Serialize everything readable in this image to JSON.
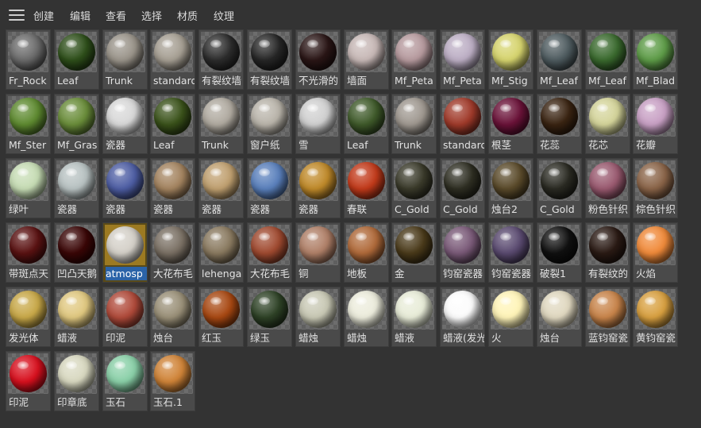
{
  "menu": [
    "创建",
    "编辑",
    "查看",
    "选择",
    "材质",
    "纹理"
  ],
  "materials": [
    {
      "label": "Fr_Rock",
      "color": "#6b6b6b"
    },
    {
      "label": "Leaf",
      "color": "#2e4f1a"
    },
    {
      "label": "Trunk",
      "color": "#9a948a"
    },
    {
      "label": "standard",
      "color": "#a69f93"
    },
    {
      "label": "有裂纹墙",
      "color": "#2c2c2c"
    },
    {
      "label": "有裂纹墙",
      "color": "#262626"
    },
    {
      "label": "不光滑的",
      "color": "#2a1616"
    },
    {
      "label": "墙面",
      "color": "#c7b8b6"
    },
    {
      "label": "Mf_Peta",
      "color": "#b69a9e"
    },
    {
      "label": "Mf_Peta",
      "color": "#bcaec4"
    },
    {
      "label": "Mf_Stig",
      "color": "#d6d46e"
    },
    {
      "label": "Mf_Leaf",
      "color": "#4f5c60"
    },
    {
      "label": "Mf_Leaf",
      "color": "#3a6a2e"
    },
    {
      "label": "Mf_Blad",
      "color": "#5e9c48"
    },
    {
      "label": "Mf_Ster",
      "color": "#5e8a30"
    },
    {
      "label": "Mf_Gras",
      "color": "#6a8d3a"
    },
    {
      "label": "瓷器",
      "color": "#d8d8d8"
    },
    {
      "label": "Leaf",
      "color": "#3a521a"
    },
    {
      "label": "Trunk",
      "color": "#b0aaa0"
    },
    {
      "label": "窗户纸",
      "color": "#b9b4aa"
    },
    {
      "label": "雪",
      "color": "#d0d0d0"
    },
    {
      "label": "Leaf",
      "color": "#3f5a2a"
    },
    {
      "label": "Trunk",
      "color": "#9f9890"
    },
    {
      "label": "standard",
      "color": "#a03a2a"
    },
    {
      "label": "根茎",
      "color": "#6a1238"
    },
    {
      "label": "花蕊",
      "color": "#3a2412"
    },
    {
      "label": "花芯",
      "color": "#d4d49a"
    },
    {
      "label": "花瓣",
      "color": "#c8a0c4"
    },
    {
      "label": "绿叶",
      "color": "#c6dcb4"
    },
    {
      "label": "瓷器",
      "color": "#b8c2c2"
    },
    {
      "label": "瓷器",
      "color": "#4e5ea4"
    },
    {
      "label": "瓷器",
      "color": "#a48460"
    },
    {
      "label": "瓷器",
      "color": "#c0a070"
    },
    {
      "label": "瓷器",
      "color": "#5a80bc"
    },
    {
      "label": "瓷器",
      "color": "#c08a2a"
    },
    {
      "label": "春联",
      "color": "#c23a1a"
    },
    {
      "label": "C_Gold",
      "color": "#3a3a2a"
    },
    {
      "label": "C_Gold",
      "color": "#2e2e22"
    },
    {
      "label": "烛台2",
      "color": "#5a4a2a"
    },
    {
      "label": "C_Gold",
      "color": "#2a2a22"
    },
    {
      "label": "粉色针织",
      "color": "#9a5a70"
    },
    {
      "label": "棕色针织",
      "color": "#8a6448"
    },
    {
      "label": "带斑点天",
      "color": "#5a1212"
    },
    {
      "label": "凹凸天鹅",
      "color": "#3a0606"
    },
    {
      "label": "atmosp",
      "color": "#d4d0c8"
    },
    {
      "label": "大花布毛",
      "color": "#7a7064"
    },
    {
      "label": "lehenga",
      "color": "#8a7a60"
    },
    {
      "label": "大花布毛",
      "color": "#a04a30"
    },
    {
      "label": "铜",
      "color": "#b08068"
    },
    {
      "label": "地板",
      "color": "#b06a3a"
    },
    {
      "label": "金",
      "color": "#4a3a1a"
    },
    {
      "label": "钧窑瓷器",
      "color": "#7a5a78"
    },
    {
      "label": "钧窑瓷器",
      "color": "#5a4a70"
    },
    {
      "label": "破裂1",
      "color": "#101010"
    },
    {
      "label": "有裂纹的",
      "color": "#2a1a14"
    },
    {
      "label": "火焰",
      "color": "#f08a3a"
    },
    {
      "label": "发光体",
      "color": "#c8a848"
    },
    {
      "label": "蜡液",
      "color": "#e0c880"
    },
    {
      "label": "印泥",
      "color": "#b04a3a"
    },
    {
      "label": "烛台",
      "color": "#9a9078"
    },
    {
      "label": "红玉",
      "color": "#a84812"
    },
    {
      "label": "绿玉",
      "color": "#2e4226"
    },
    {
      "label": "蜡烛",
      "color": "#c8c8b4"
    },
    {
      "label": "蜡烛",
      "color": "#ececdc"
    },
    {
      "label": "蜡液",
      "color": "#e8ecd8"
    },
    {
      "label": "蜡液(发光",
      "color": "#fcfcfc"
    },
    {
      "label": "火",
      "color": "#fff4b8"
    },
    {
      "label": "烛台",
      "color": "#e0d8c0"
    },
    {
      "label": "蓝钧窑瓷",
      "color": "#c8844a"
    },
    {
      "label": "黄钧窑瓷",
      "color": "#d8a040"
    },
    {
      "label": "印泥",
      "color": "#d8101e"
    },
    {
      "label": "印章底",
      "color": "#d8d8c0"
    },
    {
      "label": "玉石",
      "color": "#8ad0a8"
    },
    {
      "label": "玉石.1",
      "color": "#d08438"
    }
  ],
  "selected_label": "atmosp"
}
